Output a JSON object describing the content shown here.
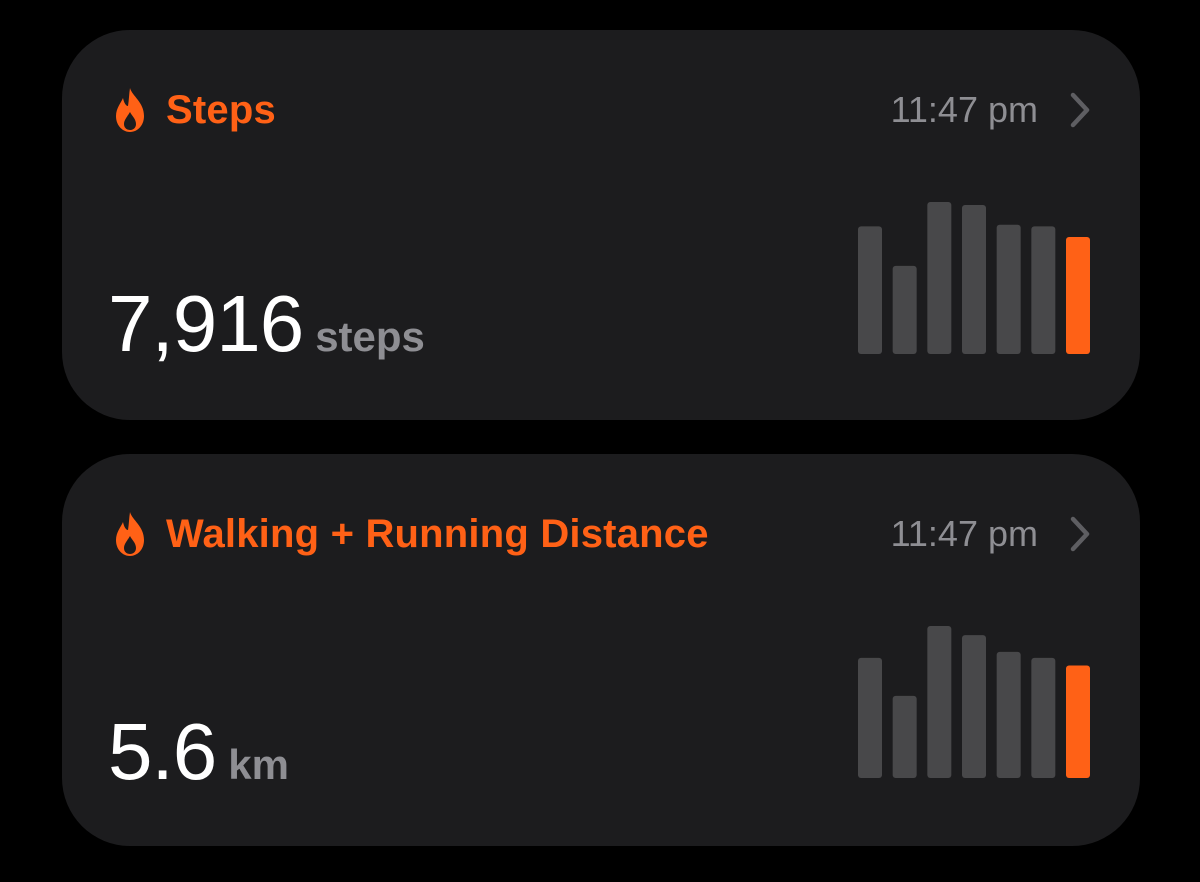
{
  "colors": {
    "accent": "#ff6116",
    "bar_inactive": "#48484a",
    "card_bg": "#1c1c1e",
    "secondary_text": "#8e8e93",
    "background": "#000000"
  },
  "cards": [
    {
      "icon": "flame-icon",
      "title": "Steps",
      "time": "11:47 pm",
      "value": "7,916",
      "unit": "steps",
      "chart_data": {
        "type": "bar",
        "values": [
          0.84,
          0.58,
          1.0,
          0.98,
          0.85,
          0.84,
          0.77
        ],
        "highlight_index": 6
      }
    },
    {
      "icon": "flame-icon",
      "title": "Walking + Running Distance",
      "time": "11:47 pm",
      "value": "5.6",
      "unit": "km",
      "chart_data": {
        "type": "bar",
        "values": [
          0.79,
          0.54,
          1.0,
          0.94,
          0.83,
          0.79,
          0.74
        ],
        "highlight_index": 6
      }
    }
  ]
}
